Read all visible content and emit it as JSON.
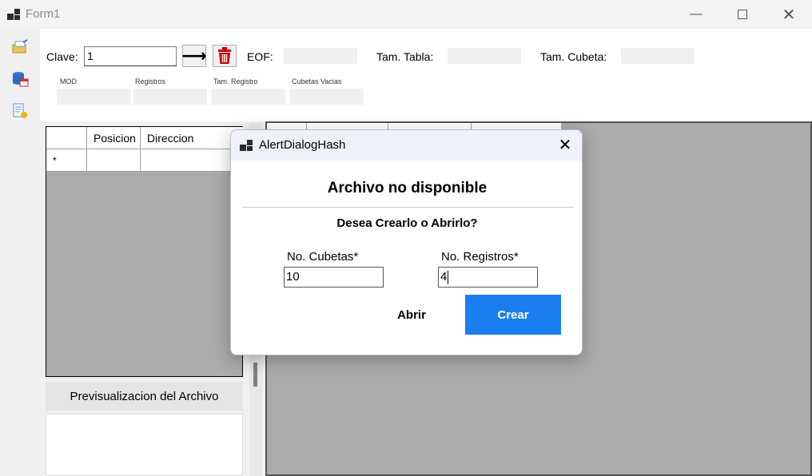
{
  "window": {
    "title": "Form1"
  },
  "toolbar": {
    "clave_label": "Clave:",
    "clave_value": "1",
    "eof_label": "EOF:",
    "tam_tabla_label": "Tam. Tabla:",
    "tam_cubeta_label": "Tam. Cubeta:",
    "mod_label": "MOD",
    "registros_label": "Registros",
    "tam_registro_label": "Tam. Registro",
    "cubetas_vacias_label": "Cubetas Vacias"
  },
  "left_grid": {
    "columns": [
      "",
      "Posicion",
      "Direccion"
    ],
    "row_marker": "*"
  },
  "preview_button": "Previsualizacion del Archivo",
  "dialog": {
    "title": "AlertDialogHash",
    "heading": "Archivo no disponible",
    "subtitle": "Desea Crearlo o Abrirlo?",
    "cubetas_label": "No. Cubetas*",
    "cubetas_value": "10",
    "registros_label": "No. Registros*",
    "registros_value": "4",
    "abrir_label": "Abrir",
    "crear_label": "Crear",
    "accent_color": "#1a7df0"
  }
}
